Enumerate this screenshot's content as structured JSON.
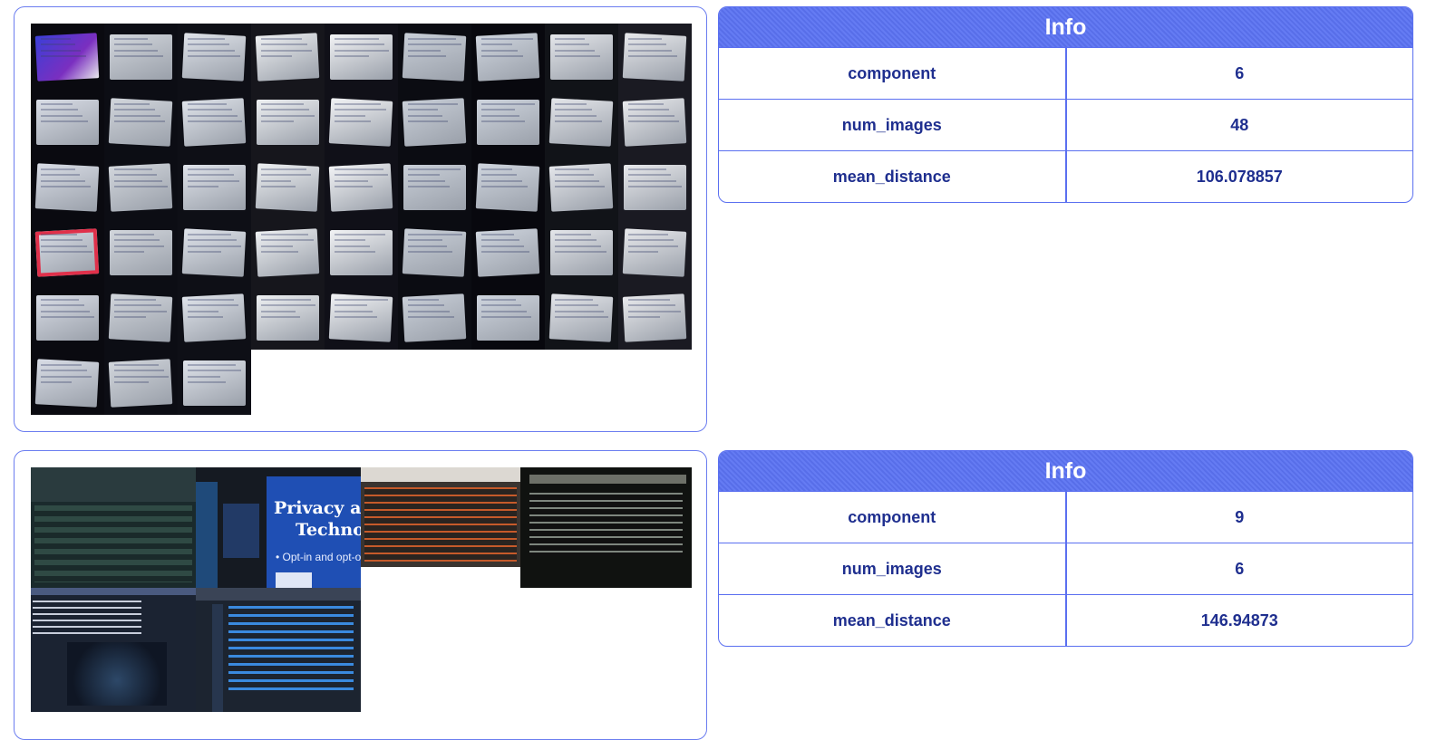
{
  "clusters": [
    {
      "info": {
        "title": "Info",
        "rows": [
          {
            "key": "component",
            "value": "6"
          },
          {
            "key": "num_images",
            "value": "48"
          },
          {
            "key": "mean_distance",
            "value": "106.078857"
          }
        ]
      }
    },
    {
      "info": {
        "title": "Info",
        "rows": [
          {
            "key": "component",
            "value": "9"
          },
          {
            "key": "num_images",
            "value": "6"
          },
          {
            "key": "mean_distance",
            "value": "146.94873"
          }
        ]
      },
      "tile_text": {
        "slide_title_line1": "Privacy a",
        "slide_title_line2": "Techno",
        "slide_bullet": "• Opt-in and opt-o"
      }
    }
  ],
  "colors": {
    "accent": "#5b73f2",
    "border": "#5a6ff0",
    "table_text": "#1f2f8f"
  }
}
